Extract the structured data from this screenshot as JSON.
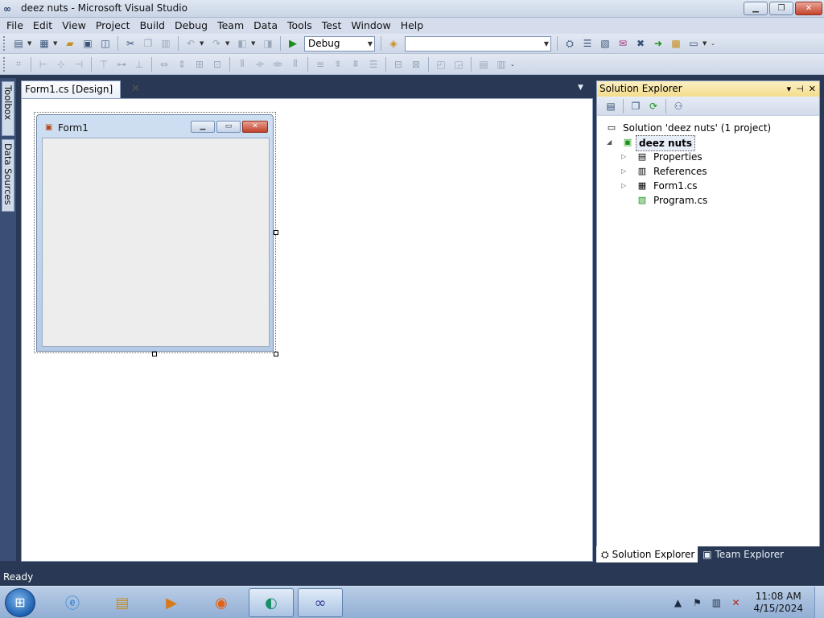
{
  "window": {
    "title": "deez nuts - Microsoft Visual Studio",
    "logo_icon": "vs-infinity-icon",
    "buttons": {
      "minimize": "▁",
      "restore": "❐",
      "close": "✕"
    }
  },
  "menu": [
    "File",
    "Edit",
    "View",
    "Project",
    "Build",
    "Debug",
    "Team",
    "Data",
    "Tools",
    "Test",
    "Window",
    "Help"
  ],
  "toolbar": {
    "config_value": "Debug",
    "platform_value": "",
    "standard_icons": [
      "new-project-icon",
      "add-item-icon",
      "open-icon",
      "save-icon",
      "save-all-icon",
      "cut-icon",
      "copy-icon",
      "paste-icon",
      "undo-icon",
      "redo-icon",
      "navigate-back-icon",
      "navigate-forward-icon",
      "start-debugging-icon",
      "find-in-files-icon",
      "solution-explorer-icon",
      "properties-icon",
      "object-browser-icon",
      "toolbox-icon",
      "extension-manager-icon",
      "start-page-icon",
      "command-window-icon"
    ],
    "layout_icons": [
      "align-to-grid-icon",
      "align-lefts-icon",
      "align-centers-icon",
      "align-rights-icon",
      "align-tops-icon",
      "align-middles-icon",
      "align-bottoms-icon",
      "make-same-width-icon",
      "make-same-height-icon",
      "size-to-grid-icon",
      "make-same-size-icon",
      "horizontal-spacing-icon",
      "increase-horizontal-spacing-icon",
      "decrease-horizontal-spacing-icon",
      "remove-horizontal-spacing-icon",
      "vertical-spacing-icon",
      "increase-vertical-spacing-icon",
      "decrease-vertical-spacing-icon",
      "remove-vertical-spacing-icon",
      "center-horizontally-icon",
      "center-vertically-icon",
      "bring-to-front-icon",
      "send-to-back-icon",
      "tab-order-icon",
      "lock-controls-icon"
    ]
  },
  "side_dock": {
    "toolbox": "Toolbox",
    "data_sources": "Data Sources"
  },
  "document": {
    "tab_label": "Form1.cs [Design]",
    "tab_close": "✕"
  },
  "form": {
    "title": "Form1",
    "background": "#ededed"
  },
  "solution_explorer": {
    "title": "Solution Explorer",
    "header_buttons": [
      "▾",
      "⊣",
      "✕"
    ],
    "toolbar_icons": [
      "show-all-files-icon",
      "properties-icon",
      "refresh-icon",
      "view-class-diagram-icon"
    ],
    "tree": [
      {
        "label": "Solution 'deez nuts' (1 project)",
        "icon": "solution-icon"
      },
      {
        "label": "deez nuts",
        "icon": "csharp-project-icon",
        "expanded": true
      },
      {
        "label": "Properties",
        "icon": "properties-folder-icon"
      },
      {
        "label": "References",
        "icon": "references-icon"
      },
      {
        "label": "Form1.cs",
        "icon": "form-file-icon"
      },
      {
        "label": "Program.cs",
        "icon": "cs-file-icon"
      }
    ],
    "tabs": [
      "Solution Explorer",
      "Team Explorer"
    ]
  },
  "status": {
    "text": "Ready"
  },
  "taskbar": {
    "apps": [
      "internet-explorer-icon",
      "windows-explorer-icon",
      "media-player-icon",
      "firefox-icon",
      "app-circle-icon",
      "visual-studio-icon"
    ],
    "time": "11:08 AM",
    "date": "4/15/2024",
    "tray_icons": [
      "show-hidden-icons-icon",
      "action-center-flag-icon",
      "network-icon",
      "volume-muted-icon"
    ]
  },
  "colors": {
    "chrome_dark": "#293955",
    "panel_header": "#f5dd8d",
    "close_red": "#c4432b"
  }
}
